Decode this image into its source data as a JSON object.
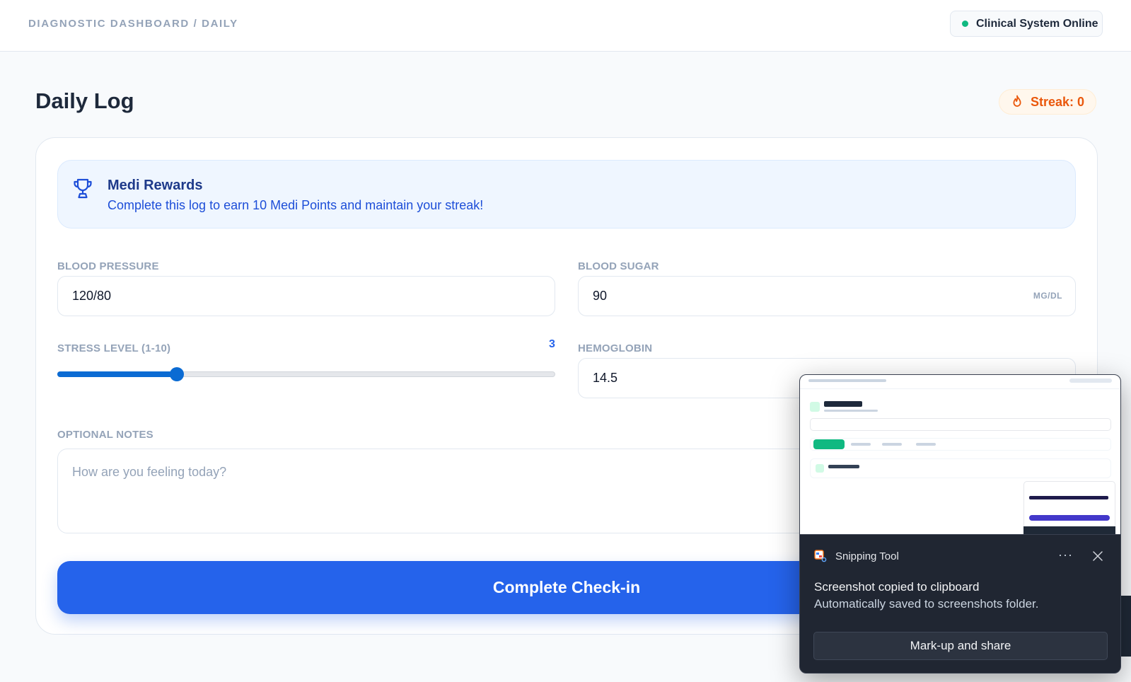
{
  "header": {
    "breadcrumb": "DIAGNOSTIC DASHBOARD / DAILY",
    "status": "Clinical System Online",
    "status_color": "#10b981"
  },
  "page": {
    "title": "Daily Log",
    "streak": "Streak: 0",
    "streak_color": "#ea580c"
  },
  "rewards": {
    "icon": "trophy-icon",
    "title": "Medi Rewards",
    "text": "Complete this log to earn 10 Medi Points and maintain your streak!"
  },
  "form": {
    "blood_pressure": {
      "label": "BLOOD PRESSURE",
      "value": "120/80"
    },
    "blood_sugar": {
      "label": "BLOOD SUGAR",
      "value": "90",
      "unit": "MG/DL"
    },
    "stress": {
      "label": "STRESS LEVEL (1-10)",
      "value": "3",
      "min": 1,
      "max": 10,
      "fraction": 0.24
    },
    "hemoglobin": {
      "label": "HEMOGLOBIN",
      "value": "14.5"
    },
    "notes": {
      "label": "OPTIONAL NOTES",
      "placeholder": "How are you feeling today?"
    },
    "submit_label": "Complete Check-in",
    "accent_color": "#2563eb"
  },
  "toast": {
    "app_name": "Snipping Tool",
    "more": "···",
    "title": "Screenshot copied to clipboard",
    "subtitle": "Automatically saved to screenshots folder.",
    "button": "Mark-up and share"
  }
}
